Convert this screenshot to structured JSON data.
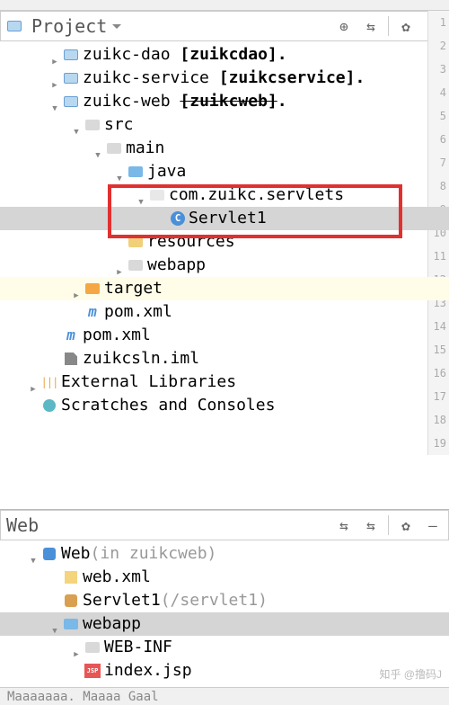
{
  "panels": {
    "project": {
      "title": "Project"
    },
    "web": {
      "title": "Web"
    }
  },
  "tree": {
    "zuikc_dao": {
      "name": "zuikc-dao",
      "module": "[zuikcdao]."
    },
    "zuikc_service": {
      "name": "zuikc-service",
      "module": "[zuikcservice]."
    },
    "zuikc_web": {
      "name": "zuikc-web",
      "module_struck": "[zuikcweb]",
      "dot": "."
    },
    "src": "src",
    "main": "main",
    "java": "java",
    "pkg": "com.zuikc.servlets",
    "servlet1": "Servlet1",
    "resources": "resources",
    "webapp": "webapp",
    "target": "target",
    "pom1": "pom.xml",
    "pom2": "pom.xml",
    "iml": "zuikcsln.iml",
    "ext_libs": "External Libraries",
    "scratches": "Scratches and Consoles"
  },
  "web": {
    "root": "Web",
    "root_suffix": " (in zuikcweb)",
    "webxml": "web.xml",
    "servlet1": "Servlet1",
    "servlet1_path": " (/servlet1)",
    "webapp": "webapp",
    "webinf": "WEB-INF",
    "indexjsp": "index.jsp"
  },
  "gutter": [
    "1",
    "2",
    "3",
    "4",
    "5",
    "6",
    "7",
    "8",
    "9",
    "10",
    "11",
    "12",
    "13",
    "14",
    "15",
    "16",
    "17",
    "18",
    "19"
  ],
  "watermark": "知乎 @撸码J",
  "bottom": "Maaaaaaa.    Maaaa Gaal"
}
